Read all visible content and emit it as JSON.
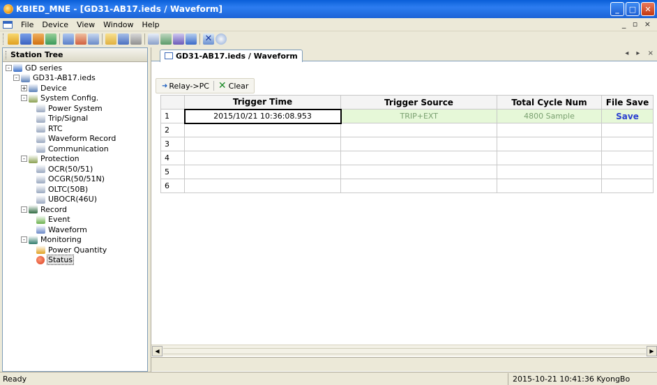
{
  "window": {
    "title": "KBIED_MNE - [GD31-AB17.ieds / Waveform]",
    "controls": [
      "minimize",
      "maximize",
      "close"
    ]
  },
  "menu": {
    "items": [
      {
        "label": "File"
      },
      {
        "label": "Device"
      },
      {
        "label": "View"
      },
      {
        "label": "Window"
      },
      {
        "label": "Help"
      }
    ],
    "mdi_controls": "_ ▫ ×"
  },
  "toolbar": {
    "icons": [
      "open-folder-icon",
      "save-icon",
      "cut-icon",
      "copy-icon",
      "chart-icon",
      "connect-icon",
      "disconnect-icon",
      "export-icon",
      "monitor-icon",
      "network-icon",
      "window-icon",
      "layout-icon",
      "tile-icon",
      "cascade-icon",
      "arrange-icon",
      "close-icon",
      "help-icon"
    ]
  },
  "station_tree": {
    "header": "Station Tree",
    "items": [
      {
        "label": "GD series",
        "level": 0,
        "expander": "-",
        "icon": "station-icon",
        "color": "#3a6fc8"
      },
      {
        "label": "GD31-AB17.ieds",
        "level": 1,
        "expander": "-",
        "icon": "device-file-icon",
        "color": "#5a7fb8"
      },
      {
        "label": "Device",
        "level": 2,
        "expander": "+",
        "icon": "device-icon",
        "color": "#5a7fb8"
      },
      {
        "label": "System Config.",
        "level": 2,
        "expander": "-",
        "icon": "gears-icon",
        "color": "#8aa050"
      },
      {
        "label": "Power System",
        "level": 3,
        "expander": "",
        "icon": "settings-doc-icon",
        "color": "#9aa8c0"
      },
      {
        "label": "Trip/Signal",
        "level": 3,
        "expander": "",
        "icon": "settings-doc-icon",
        "color": "#9aa8c0"
      },
      {
        "label": "RTC",
        "level": 3,
        "expander": "",
        "icon": "settings-doc-icon",
        "color": "#9aa8c0"
      },
      {
        "label": "Waveform Record",
        "level": 3,
        "expander": "",
        "icon": "settings-doc-icon",
        "color": "#9aa8c0"
      },
      {
        "label": "Communication",
        "level": 3,
        "expander": "",
        "icon": "settings-doc-icon",
        "color": "#9aa8c0"
      },
      {
        "label": "Protection",
        "level": 2,
        "expander": "-",
        "icon": "gears-icon",
        "color": "#8aa050"
      },
      {
        "label": "OCR(50/51)",
        "level": 3,
        "expander": "",
        "icon": "settings-doc-icon",
        "color": "#9aa8c0"
      },
      {
        "label": "OCGR(50/51N)",
        "level": 3,
        "expander": "",
        "icon": "settings-doc-icon",
        "color": "#9aa8c0"
      },
      {
        "label": "OLTC(50B)",
        "level": 3,
        "expander": "",
        "icon": "settings-doc-icon",
        "color": "#9aa8c0"
      },
      {
        "label": "UBOCR(46U)",
        "level": 3,
        "expander": "",
        "icon": "settings-doc-icon",
        "color": "#9aa8c0"
      },
      {
        "label": "Record",
        "level": 2,
        "expander": "-",
        "icon": "record-icon",
        "color": "#2f6b40"
      },
      {
        "label": "Event",
        "level": 3,
        "expander": "",
        "icon": "event-table-icon",
        "color": "#6ab04c"
      },
      {
        "label": "Waveform",
        "level": 3,
        "expander": "",
        "icon": "waveform-icon",
        "color": "#6a88c8"
      },
      {
        "label": "Monitoring",
        "level": 2,
        "expander": "-",
        "icon": "monitoring-icon",
        "color": "#2f7a6a"
      },
      {
        "label": "Power Quantity",
        "level": 3,
        "expander": "",
        "icon": "bar-chart-icon",
        "color": "#e0a020"
      },
      {
        "label": "Status",
        "level": 3,
        "expander": "",
        "icon": "status-light-icon",
        "color": "#d83a1a",
        "selected": true
      }
    ]
  },
  "document": {
    "tab_label": "GD31-AB17.ieds / Waveform",
    "tab_nav": "◂ ▸ ×",
    "actions": {
      "relay_to_pc": "Relay->PC",
      "clear": "Clear"
    },
    "table": {
      "columns": [
        "",
        "Trigger Time",
        "Trigger Source",
        "Total Cycle Num",
        "File Save"
      ],
      "rows": [
        {
          "num": "1",
          "trigger_time": "2015/10/21 10:36:08.953",
          "trigger_source": "TRIP+EXT",
          "total_cycle": "4800 Sample",
          "file_save": "Save"
        },
        {
          "num": "2",
          "trigger_time": "",
          "trigger_source": "",
          "total_cycle": "",
          "file_save": ""
        },
        {
          "num": "3",
          "trigger_time": "",
          "trigger_source": "",
          "total_cycle": "",
          "file_save": ""
        },
        {
          "num": "4",
          "trigger_time": "",
          "trigger_source": "",
          "total_cycle": "",
          "file_save": ""
        },
        {
          "num": "5",
          "trigger_time": "",
          "trigger_source": "",
          "total_cycle": "",
          "file_save": ""
        },
        {
          "num": "6",
          "trigger_time": "",
          "trigger_source": "",
          "total_cycle": "",
          "file_save": ""
        }
      ]
    }
  },
  "statusbar": {
    "left": "Ready",
    "right": "2015-10-21 10:41:36  KyongBo"
  },
  "colors": {
    "title_bar": "#1c63d6",
    "row_highlight": "#e6f8d8",
    "save_link": "#2a3fd0"
  }
}
